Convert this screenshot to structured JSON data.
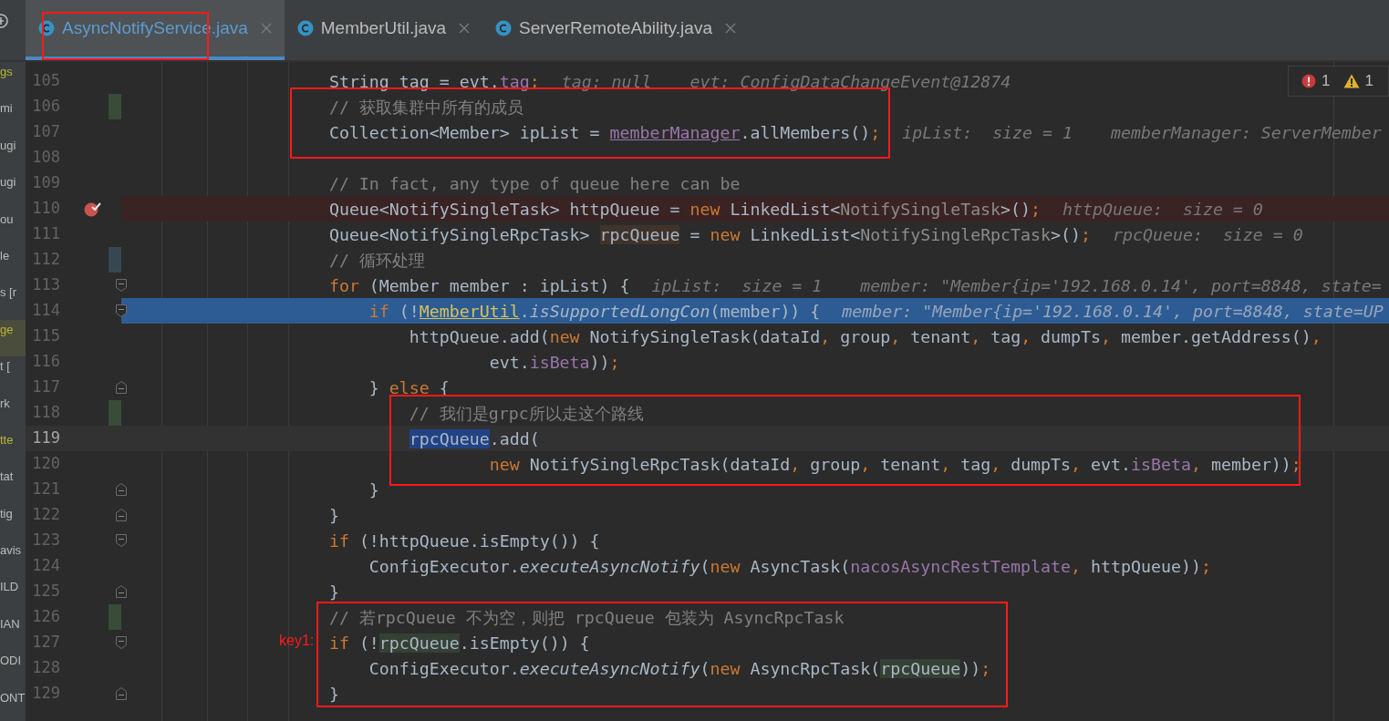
{
  "project_tree": [
    {
      "label": "gs",
      "selected": false,
      "color": "#b9b435"
    },
    {
      "label": "mi",
      "selected": false,
      "color": "#bbbbbb"
    },
    {
      "label": "ugi",
      "selected": false,
      "color": "#bbbbbb"
    },
    {
      "label": "ugi",
      "selected": false,
      "color": "#bbbbbb"
    },
    {
      "label": "ou",
      "selected": false,
      "color": "#bbbbbb"
    },
    {
      "label": "le",
      "selected": false,
      "color": "#bbbbbb"
    },
    {
      "label": "s [r",
      "selected": false,
      "color": "#bbbbbb"
    },
    {
      "label": "ge",
      "selected": true,
      "color": "#b9b435"
    },
    {
      "label": "t [",
      "selected": false,
      "color": "#bbbbbb"
    },
    {
      "label": "rk",
      "selected": false,
      "color": "#bbbbbb"
    },
    {
      "label": "tte",
      "selected": false,
      "color": "#b9b435"
    },
    {
      "label": "tat",
      "selected": false,
      "color": "#bbbbbb"
    },
    {
      "label": "tig",
      "selected": false,
      "color": "#bbbbbb"
    },
    {
      "label": "avis",
      "selected": false,
      "color": "#bbbbbb"
    },
    {
      "label": "ILD",
      "selected": false,
      "color": "#bbbbbb"
    },
    {
      "label": "IAN",
      "selected": false,
      "color": "#bbbbbb"
    },
    {
      "label": "ODI",
      "selected": false,
      "color": "#bbbbbb"
    },
    {
      "label": "ONT",
      "selected": false,
      "color": "#bbbbbb"
    }
  ],
  "tabs": [
    {
      "label": "AsyncNotifyService.java",
      "selected": true
    },
    {
      "label": "MemberUtil.java",
      "selected": false
    },
    {
      "label": "ServerRemoteAbility.java",
      "selected": false
    }
  ],
  "problems": {
    "errors": "1",
    "warnings": "1"
  },
  "annotation_note": "key1:",
  "lines": [
    {
      "number": "105",
      "kind": "normal",
      "code": [
        {
          "kind": "plain",
          "text": "        String tag = evt."
        },
        {
          "kind": "field",
          "text": "tag"
        },
        {
          "kind": "punct",
          "text": ";"
        }
      ],
      "hints": [
        "tag: null",
        "evt: ConfigDataChangeEvent@12874"
      ]
    },
    {
      "number": "106",
      "kind": "normal",
      "markers": [
        {
          "kind": "change-added"
        }
      ],
      "code": [
        {
          "kind": "comment",
          "text": "        // 获取集群中所有的成员"
        }
      ]
    },
    {
      "number": "107",
      "kind": "normal",
      "code": [
        {
          "kind": "plain",
          "text": "        Collection<Member> ipList = "
        },
        {
          "kind": "field-link",
          "text": "memberManager"
        },
        {
          "kind": "plain",
          "text": ".allMembers()"
        },
        {
          "kind": "punct",
          "text": ";"
        }
      ],
      "hints": [
        "ipList:  size = 1",
        "memberManager: ServerMember"
      ]
    },
    {
      "number": "108",
      "kind": "normal"
    },
    {
      "number": "109",
      "kind": "normal",
      "code": [
        {
          "kind": "comment",
          "text": "        // In fact, any type of queue here can be"
        }
      ]
    },
    {
      "number": "110",
      "kind": "breakpoint",
      "code": [
        {
          "kind": "plain",
          "text": "        Queue<NotifySingleTask> httpQueue = "
        },
        {
          "kind": "keyword",
          "text": "new"
        },
        {
          "kind": "plain",
          "text": " LinkedList<"
        },
        {
          "kind": "type-arg",
          "text": "NotifySingleTask"
        },
        {
          "kind": "plain",
          "text": ">()"
        },
        {
          "kind": "punct",
          "text": ";"
        }
      ],
      "hints": [
        "httpQueue:  size = 0"
      ]
    },
    {
      "number": "111",
      "kind": "normal",
      "code": [
        {
          "kind": "plain",
          "text": "        Queue<NotifySingleRpcTask> "
        },
        {
          "kind": "write-usage",
          "text": "rpcQueue"
        },
        {
          "kind": "plain",
          "text": " = "
        },
        {
          "kind": "keyword",
          "text": "new"
        },
        {
          "kind": "plain",
          "text": " LinkedList<"
        },
        {
          "kind": "type-arg",
          "text": "NotifySingleRpcTask"
        },
        {
          "kind": "plain",
          "text": ">()"
        },
        {
          "kind": "punct",
          "text": ";"
        }
      ],
      "hints": [
        "rpcQueue:  size = 0"
      ]
    },
    {
      "number": "112",
      "kind": "normal",
      "markers": [
        {
          "kind": "change-modified"
        }
      ],
      "code": [
        {
          "kind": "comment",
          "text": "        // 循环处理"
        }
      ]
    },
    {
      "number": "113",
      "kind": "normal",
      "markers": [
        {
          "kind": "fold-start"
        }
      ],
      "code": [
        {
          "kind": "keyword",
          "text": "        for"
        },
        {
          "kind": "plain",
          "text": " (Member member : ipList) {"
        }
      ],
      "hints": [
        "ipList:  size = 1",
        "member: \"Member{ip='192.168.0.14', port=8848, state="
      ]
    },
    {
      "number": "114",
      "kind": "execution",
      "markers": [
        {
          "kind": "fold-start"
        }
      ],
      "code": [
        {
          "kind": "keyword",
          "text": "            if"
        },
        {
          "kind": "plain",
          "text": " (!"
        },
        {
          "kind": "class-link",
          "text": "MemberUtil"
        },
        {
          "kind": "plain",
          "text": "."
        },
        {
          "kind": "static",
          "text": "isSupportedLongCon"
        },
        {
          "kind": "plain",
          "text": "(member)) {"
        }
      ],
      "hints": [
        "member: \"Member{ip='192.168.0.14', port=8848, state=UP"
      ]
    },
    {
      "number": "115",
      "kind": "normal",
      "code": [
        {
          "kind": "plain",
          "text": "                httpQueue.add("
        },
        {
          "kind": "keyword",
          "text": "new"
        },
        {
          "kind": "plain",
          "text": " NotifySingleTask(dataId"
        },
        {
          "kind": "punct",
          "text": ","
        },
        {
          "kind": "plain",
          "text": " group"
        },
        {
          "kind": "punct",
          "text": ","
        },
        {
          "kind": "plain",
          "text": " tenant"
        },
        {
          "kind": "punct",
          "text": ","
        },
        {
          "kind": "plain",
          "text": " tag"
        },
        {
          "kind": "punct",
          "text": ","
        },
        {
          "kind": "plain",
          "text": " dumpTs"
        },
        {
          "kind": "punct",
          "text": ","
        },
        {
          "kind": "plain",
          "text": " member.getAddress()"
        },
        {
          "kind": "punct",
          "text": ","
        }
      ]
    },
    {
      "number": "116",
      "kind": "normal",
      "code": [
        {
          "kind": "plain",
          "text": "                        evt."
        },
        {
          "kind": "field",
          "text": "isBeta"
        },
        {
          "kind": "plain",
          "text": "))"
        },
        {
          "kind": "punct",
          "text": ";"
        }
      ]
    },
    {
      "number": "117",
      "kind": "normal",
      "markers": [
        {
          "kind": "fold-end"
        }
      ],
      "code": [
        {
          "kind": "plain",
          "text": "            } "
        },
        {
          "kind": "keyword",
          "text": "else"
        },
        {
          "kind": "plain",
          "text": " {"
        }
      ]
    },
    {
      "number": "118",
      "kind": "normal",
      "markers": [
        {
          "kind": "change-added"
        }
      ],
      "code": [
        {
          "kind": "comment",
          "text": "                // 我们是grpc所以走这个路线"
        }
      ]
    },
    {
      "number": "119",
      "kind": "caret",
      "code": [
        {
          "kind": "selected",
          "text": "                rpcQueue"
        },
        {
          "kind": "plain",
          "text": ".add("
        }
      ]
    },
    {
      "number": "120",
      "kind": "normal",
      "code": [
        {
          "kind": "keyword",
          "text": "                        new"
        },
        {
          "kind": "plain",
          "text": " NotifySingleRpcTask(dataId"
        },
        {
          "kind": "punct",
          "text": ","
        },
        {
          "kind": "plain",
          "text": " group"
        },
        {
          "kind": "punct",
          "text": ","
        },
        {
          "kind": "plain",
          "text": " tenant"
        },
        {
          "kind": "punct",
          "text": ","
        },
        {
          "kind": "plain",
          "text": " tag"
        },
        {
          "kind": "punct",
          "text": ","
        },
        {
          "kind": "plain",
          "text": " dumpTs"
        },
        {
          "kind": "punct",
          "text": ","
        },
        {
          "kind": "plain",
          "text": " evt."
        },
        {
          "kind": "field",
          "text": "isBeta"
        },
        {
          "kind": "punct",
          "text": ","
        },
        {
          "kind": "plain",
          "text": " member))"
        },
        {
          "kind": "punct",
          "text": ";"
        }
      ]
    },
    {
      "number": "121",
      "kind": "normal",
      "markers": [
        {
          "kind": "fold-end"
        }
      ],
      "code": [
        {
          "kind": "plain",
          "text": "            }"
        }
      ]
    },
    {
      "number": "122",
      "kind": "normal",
      "markers": [
        {
          "kind": "fold-end"
        }
      ],
      "code": [
        {
          "kind": "plain",
          "text": "        }"
        }
      ]
    },
    {
      "number": "123",
      "kind": "normal",
      "markers": [
        {
          "kind": "fold-start"
        }
      ],
      "code": [
        {
          "kind": "keyword",
          "text": "        if"
        },
        {
          "kind": "plain",
          "text": " (!httpQueue.isEmpty()) {"
        }
      ]
    },
    {
      "number": "124",
      "kind": "normal",
      "code": [
        {
          "kind": "plain",
          "text": "            ConfigExecutor."
        },
        {
          "kind": "static",
          "text": "executeAsyncNotify"
        },
        {
          "kind": "plain",
          "text": "("
        },
        {
          "kind": "keyword",
          "text": "new"
        },
        {
          "kind": "plain",
          "text": " AsyncTask("
        },
        {
          "kind": "field",
          "text": "nacosAsyncRestTemplate"
        },
        {
          "kind": "punct",
          "text": ","
        },
        {
          "kind": "plain",
          "text": " httpQueue))"
        },
        {
          "kind": "punct",
          "text": ";"
        }
      ]
    },
    {
      "number": "125",
      "kind": "normal",
      "markers": [
        {
          "kind": "fold-end"
        }
      ],
      "code": [
        {
          "kind": "plain",
          "text": "        }"
        }
      ]
    },
    {
      "number": "126",
      "kind": "normal",
      "markers": [
        {
          "kind": "change-added"
        }
      ],
      "code": [
        {
          "kind": "comment",
          "text": "        // 若rpcQueue 不为空，则把 rpcQueue 包装为 AsyncRpcTask"
        }
      ]
    },
    {
      "number": "127",
      "kind": "normal",
      "markers": [
        {
          "kind": "fold-start"
        }
      ],
      "code": [
        {
          "kind": "keyword",
          "text": "        if"
        },
        {
          "kind": "plain",
          "text": " (!"
        },
        {
          "kind": "read-usage",
          "text": "rpcQueue"
        },
        {
          "kind": "plain",
          "text": ".isEmpty()) {"
        }
      ]
    },
    {
      "number": "128",
      "kind": "normal",
      "code": [
        {
          "kind": "plain",
          "text": "            ConfigExecutor."
        },
        {
          "kind": "static",
          "text": "executeAsyncNotify"
        },
        {
          "kind": "plain",
          "text": "("
        },
        {
          "kind": "keyword",
          "text": "new"
        },
        {
          "kind": "plain",
          "text": " AsyncRpcTask("
        },
        {
          "kind": "read-usage",
          "text": "rpcQueue"
        },
        {
          "kind": "plain",
          "text": "))"
        },
        {
          "kind": "punct",
          "text": ";"
        }
      ]
    },
    {
      "number": "129",
      "kind": "normal",
      "markers": [
        {
          "kind": "fold-end"
        }
      ],
      "code": [
        {
          "kind": "plain",
          "text": "        }"
        }
      ]
    }
  ]
}
